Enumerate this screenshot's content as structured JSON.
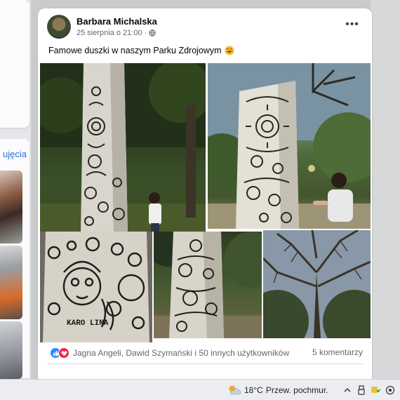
{
  "post": {
    "author": "Barbara Michalska",
    "timestamp": "25 sierpnia o 21:00",
    "meta_separator": "·",
    "more_label": "•••",
    "caption": "Famowe duszki w naszym Parku Zdrojowym",
    "caption_emoji": "smiling-face-emoji",
    "reactions_text": "Jagna Angeli, Dawid Szymański i 50 innych użytkowników",
    "comments_text": "5 komentarzy",
    "photo_text": "KARO LINA"
  },
  "left_panel": {
    "link_text": "ujęcia"
  },
  "taskbar": {
    "temperature": "18°C",
    "weather_text": "Przew. pochmur."
  },
  "colors": {
    "accent": "#2d88ff",
    "love": "#f0284a",
    "text": "#050505",
    "secondary": "#65676b"
  }
}
